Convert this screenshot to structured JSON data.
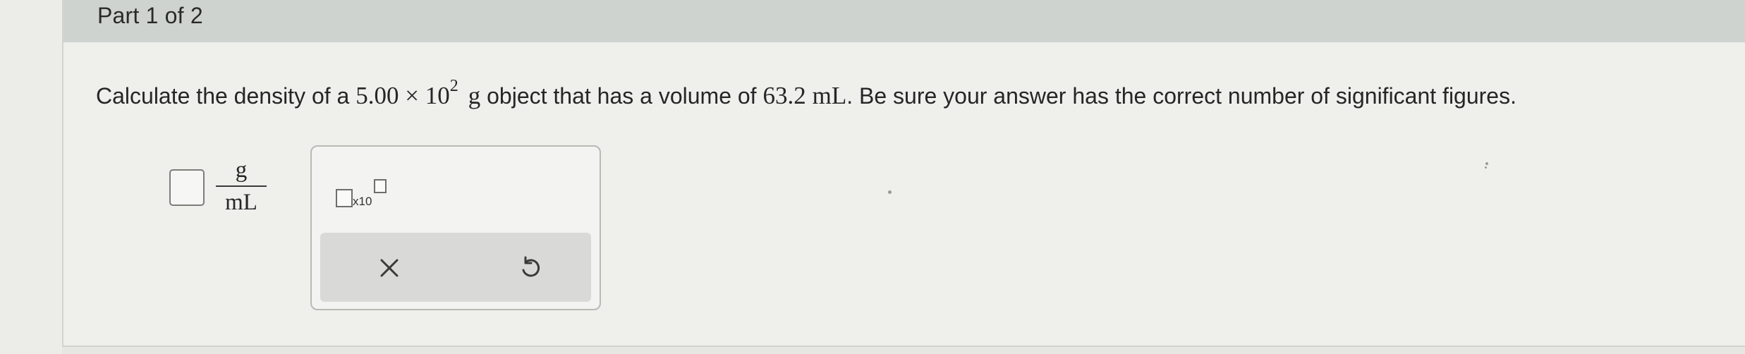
{
  "header": {
    "part_label": "Part 1 of 2"
  },
  "question": {
    "prefix": "Calculate the density of a ",
    "mass_mantissa": "5.00",
    "times": " × ",
    "mass_base": "10",
    "mass_exponent": "2",
    "mass_unit": "g",
    "middle": " object that has a volume of ",
    "volume_value": "63.2",
    "volume_unit": "mL",
    "suffix": ". Be sure your answer has the correct number of significant figures."
  },
  "answer": {
    "value": "",
    "unit_numerator": "g",
    "unit_denominator": "mL"
  },
  "tools": {
    "sci_notation_label": "x10",
    "clear_icon": "close-icon",
    "undo_icon": "undo-icon"
  }
}
